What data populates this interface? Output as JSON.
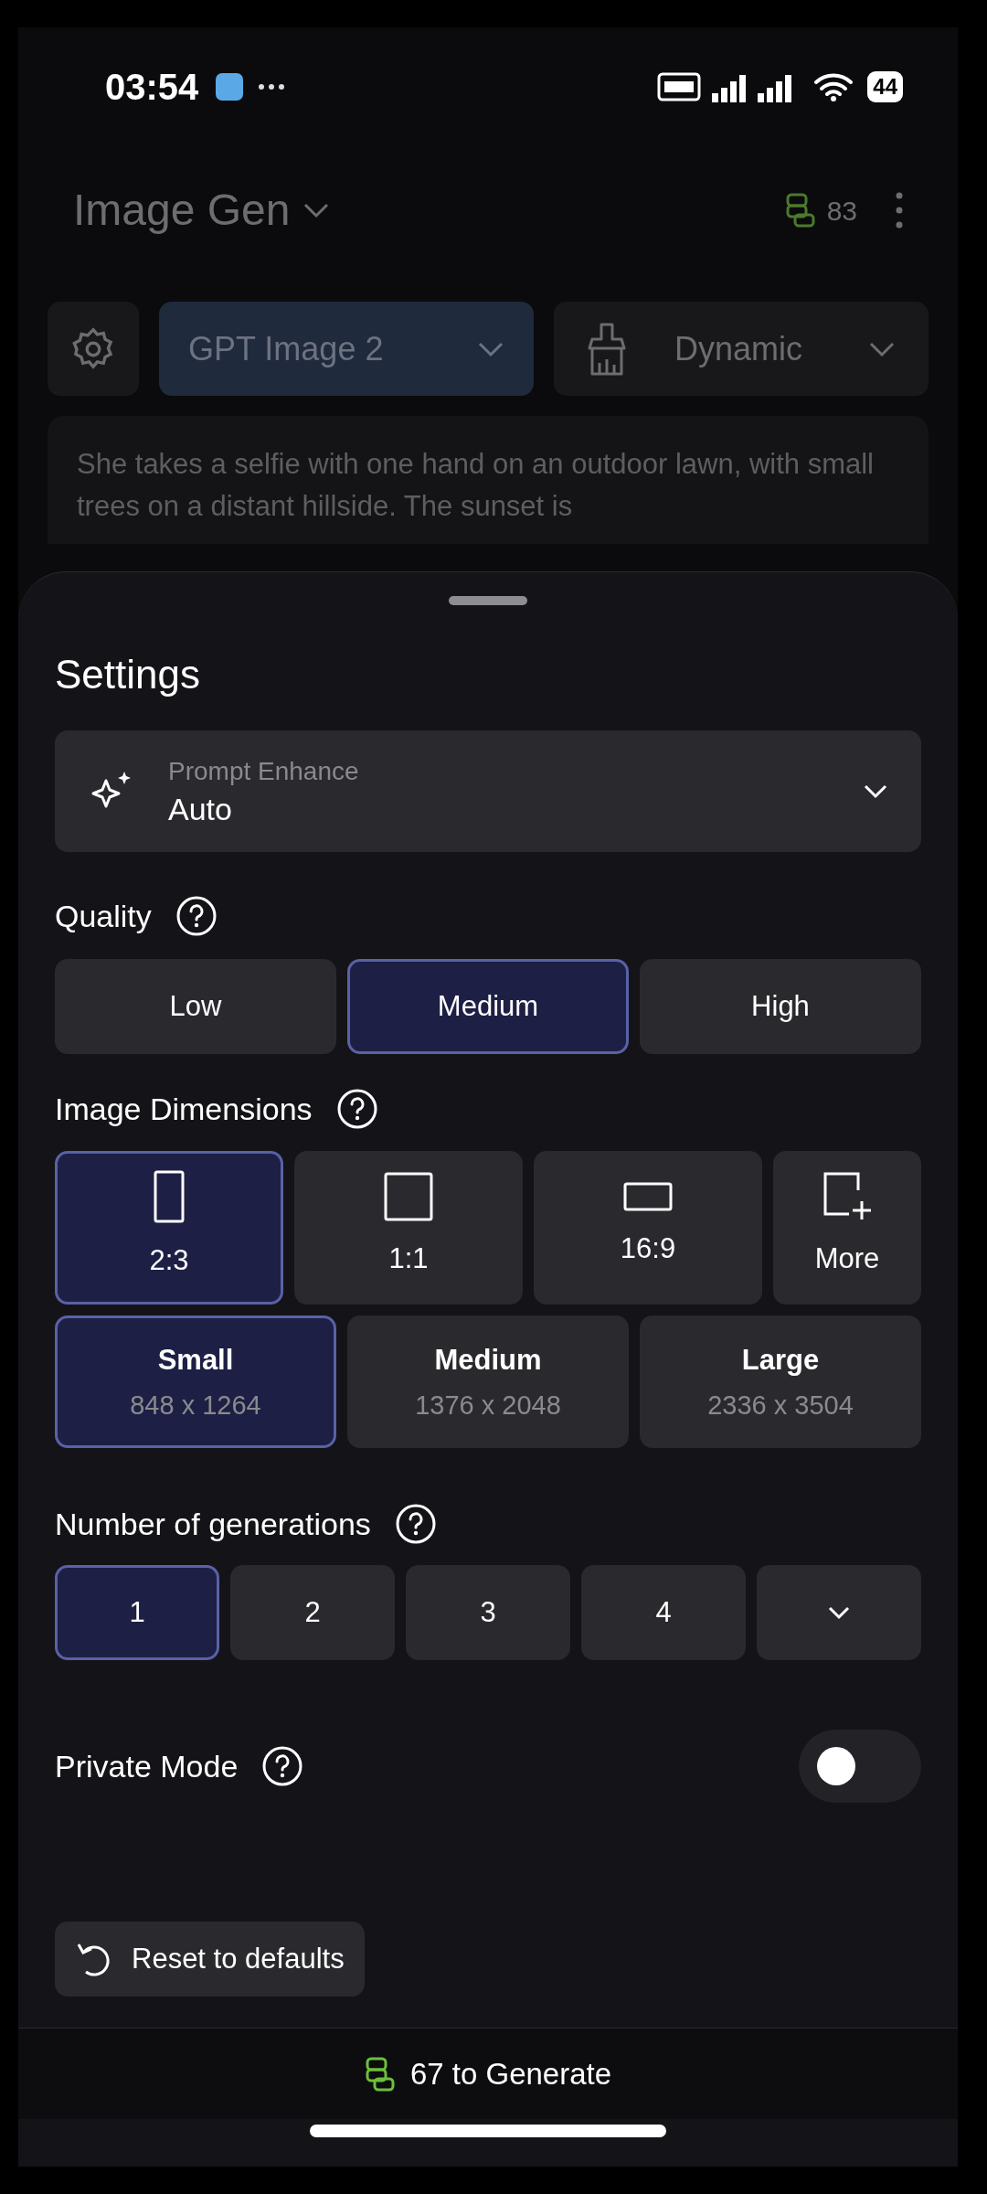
{
  "status_bar": {
    "time": "03:54",
    "battery": "44"
  },
  "header": {
    "title": "Image Gen",
    "credits": "83"
  },
  "toolbar": {
    "model": "GPT Image 2",
    "style": "Dynamic"
  },
  "prompt": {
    "text": "She takes a selfie with one hand on an outdoor lawn, with small trees on a distant hillside. The sunset is"
  },
  "settings": {
    "title": "Settings",
    "prompt_enhance": {
      "label": "Prompt Enhance",
      "value": "Auto"
    },
    "quality": {
      "label": "Quality",
      "options": [
        {
          "label": "Low",
          "selected": false
        },
        {
          "label": "Medium",
          "selected": true
        },
        {
          "label": "High",
          "selected": false
        }
      ]
    },
    "dimensions": {
      "label": "Image Dimensions",
      "aspect_ratios": [
        {
          "kind": "portrait",
          "label": "2:3",
          "selected": true
        },
        {
          "kind": "square",
          "label": "1:1",
          "selected": false
        },
        {
          "kind": "landscape",
          "label": "16:9",
          "selected": false
        },
        {
          "kind": "more",
          "label": "More",
          "selected": false
        }
      ],
      "sizes": [
        {
          "label": "Small",
          "resolution": "848 x 1264",
          "selected": true
        },
        {
          "label": "Medium",
          "resolution": "1376 x 2048",
          "selected": false
        },
        {
          "label": "Large",
          "resolution": "2336 x 3504",
          "selected": false
        }
      ]
    },
    "generations": {
      "label": "Number of generations",
      "options": [
        {
          "kind": "number",
          "label": "1",
          "selected": true
        },
        {
          "kind": "number",
          "label": "2",
          "selected": false
        },
        {
          "kind": "number",
          "label": "3",
          "selected": false
        },
        {
          "kind": "number",
          "label": "4",
          "selected": false
        },
        {
          "kind": "dropdown",
          "selected": false
        }
      ]
    },
    "private_mode": {
      "label": "Private Mode",
      "on": false
    },
    "reset_button": "Reset to defaults"
  },
  "generate_button": "67 to Generate"
}
